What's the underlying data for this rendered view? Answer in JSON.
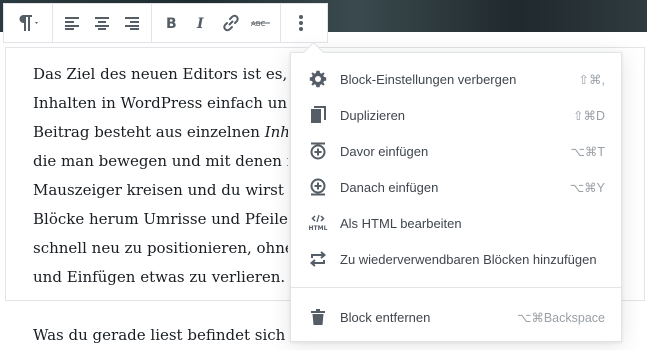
{
  "toolbar": {
    "buttons": [
      {
        "name": "paragraph",
        "icon": "paragraph-icon"
      },
      {
        "name": "align-left",
        "icon": "align-left-icon"
      },
      {
        "name": "align-center",
        "icon": "align-center-icon"
      },
      {
        "name": "align-right",
        "icon": "align-right-icon"
      },
      {
        "name": "bold",
        "icon": "bold-icon"
      },
      {
        "name": "italic",
        "icon": "italic-icon"
      },
      {
        "name": "link",
        "icon": "link-icon"
      },
      {
        "name": "strikethrough",
        "icon": "strikethrough-icon"
      },
      {
        "name": "more-options",
        "icon": "kebab-icon"
      }
    ]
  },
  "content": {
    "lines": [
      "Das Ziel des neuen Editors ist es, d",
      "Inhalten in WordPress einfach un",
      "Beitrag besteht aus einzelnen ",
      "die man bewegen und mit denen i",
      "Mauszeiger kreisen und du wirst i",
      "Blöcke herum Umrisse und Pfeile",
      "schnell neu zu positionieren, ohne",
      "und Einfügen etwas zu verlieren."
    ],
    "line3_italic": "Inha",
    "next_paragraph": "Was du gerade liest befindet sich i"
  },
  "menu": {
    "items": [
      {
        "label": "Block-Einstellungen verbergen",
        "shortcut": "⇧⌘,",
        "icon": "gear-icon"
      },
      {
        "label": "Duplizieren",
        "shortcut": "⇧⌘D",
        "icon": "duplicate-icon"
      },
      {
        "label": "Davor einfügen",
        "shortcut": "⌥⌘T",
        "icon": "insert-before-icon"
      },
      {
        "label": "Danach einfügen",
        "shortcut": "⌥⌘Y",
        "icon": "insert-after-icon"
      },
      {
        "label": "Als HTML bearbeiten",
        "shortcut": "",
        "icon": "html-icon"
      },
      {
        "label": "Zu wiederverwendbaren Blöcken hinzufügen",
        "shortcut": "",
        "icon": "reusable-block-icon"
      },
      {
        "label": "Block entfernen",
        "shortcut": "⌥⌘Backspace",
        "icon": "trash-icon"
      }
    ]
  }
}
